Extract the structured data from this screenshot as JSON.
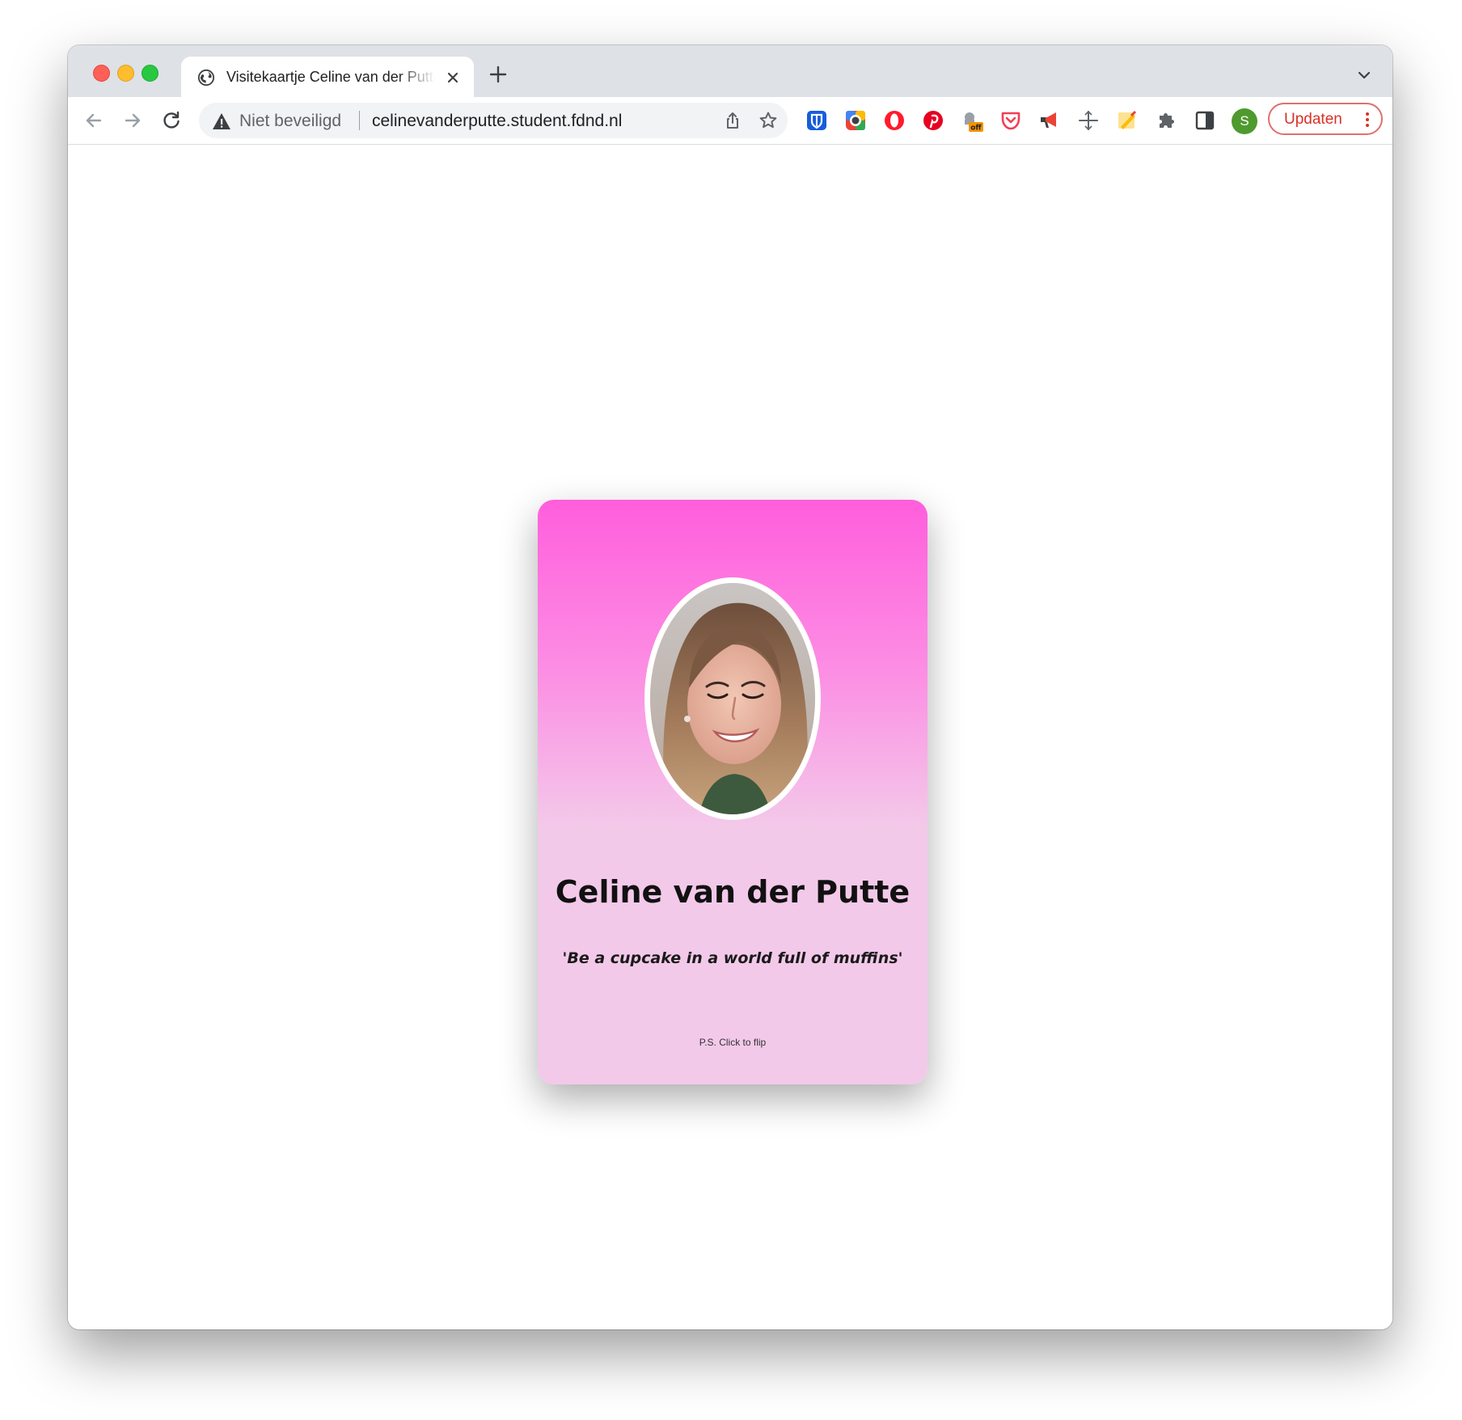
{
  "tab": {
    "title": "Visitekaartje Celine van der Putte"
  },
  "toolbar": {
    "security_label": "Niet beveiligd",
    "url": "celinevanderputte.student.fdnd.nl",
    "update_label": "Updaten",
    "profile_initial": "S"
  },
  "extensions": [
    {
      "name": "bitwarden-icon",
      "color": "#175ddc"
    },
    {
      "name": "colorpicker-icon",
      "color": "#4285f4"
    },
    {
      "name": "opera-icon",
      "color": "#ff1b2d"
    },
    {
      "name": "pinterest-icon",
      "color": "#e60023"
    },
    {
      "name": "off-badge-extension-icon",
      "color": "#f29400"
    },
    {
      "name": "pocket-icon",
      "color": "#ef4056"
    },
    {
      "name": "megaphone-icon",
      "color": "#ea4335"
    },
    {
      "name": "move-cross-icon",
      "color": "#5f6368"
    },
    {
      "name": "pencil-sheet-icon",
      "color": "#fbbc04"
    },
    {
      "name": "puzzle-extensions-icon",
      "color": "#5f6368"
    },
    {
      "name": "side-panel-icon",
      "color": "#3c4043"
    }
  ],
  "card": {
    "name": "Celine van der Putte",
    "quote": "'Be a cupcake in a world full of muffins'",
    "hint": "P.S. Click to flip",
    "colors": {
      "top": "#ff5edc",
      "bottom": "#f3c9e9"
    }
  }
}
